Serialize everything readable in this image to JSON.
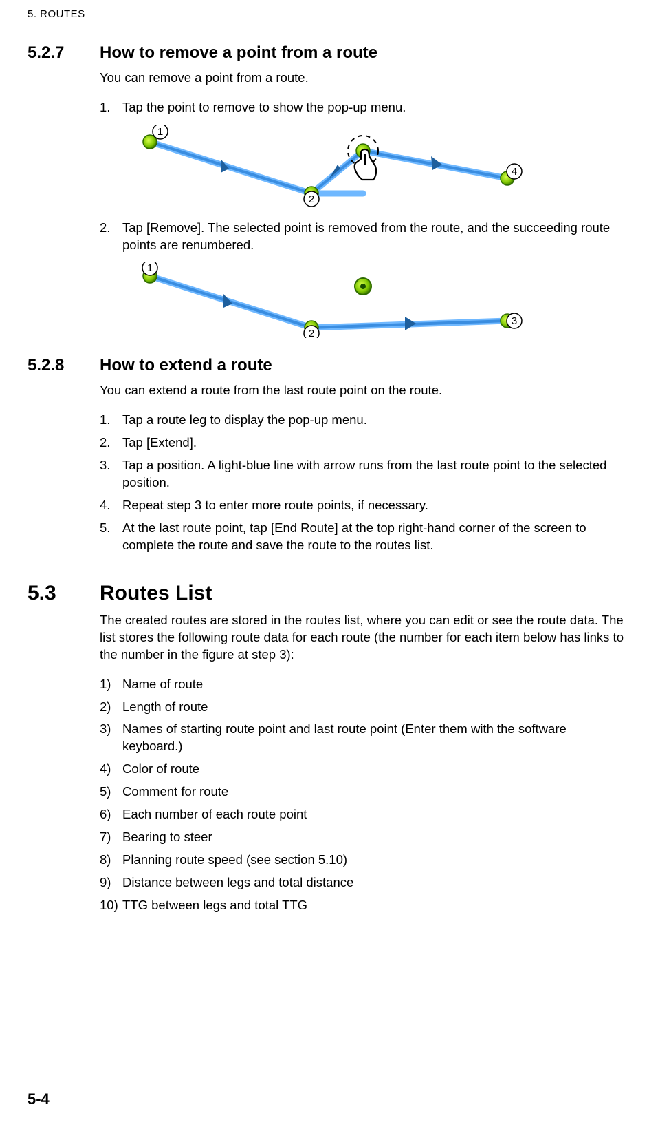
{
  "runningHead": "5.  ROUTES",
  "pageNumber": "5-4",
  "s527": {
    "num": "5.2.7",
    "title": "How to remove a point from a route",
    "intro": "You can remove a point from a route.",
    "steps": [
      {
        "n": "1.",
        "t": "Tap the point to remove to show the pop-up menu."
      },
      {
        "n": "2.",
        "t": "Tap [Remove]. The selected point is removed from the route, and the succeeding route points are renumbered."
      }
    ],
    "fig1": {
      "labels": [
        "1",
        "2",
        "4"
      ]
    },
    "fig2": {
      "labels": [
        "1",
        "2",
        "3"
      ]
    }
  },
  "s528": {
    "num": "5.2.8",
    "title": "How to extend a route",
    "intro": "You can extend a route from the last route point on the route.",
    "steps": [
      {
        "n": "1.",
        "t": "Tap a route leg to display the pop-up menu."
      },
      {
        "n": "2.",
        "t": "Tap [Extend]."
      },
      {
        "n": "3.",
        "t": "Tap a position. A light-blue line with arrow runs from the last route point to the selected position."
      },
      {
        "n": "4.",
        "t": "Repeat step 3 to enter more route points, if necessary."
      },
      {
        "n": "5.",
        "t": "At the last route point, tap [End Route] at the top right-hand corner of the screen to complete the route and save the route to the routes list."
      }
    ]
  },
  "s53": {
    "num": "5.3",
    "title": "Routes List",
    "intro": "The created routes are stored in the routes list, where you can edit or see the route data. The list stores the following route data for each route (the number for each item below has links to the number in the figure at step 3):",
    "items": [
      {
        "n": "1)",
        "t": "Name of route"
      },
      {
        "n": "2)",
        "t": "Length of route"
      },
      {
        "n": "3)",
        "t": "Names of starting route point and last route point (Enter them with the software keyboard.)"
      },
      {
        "n": "4)",
        "t": "Color of route"
      },
      {
        "n": "5)",
        "t": "Comment for route"
      },
      {
        "n": "6)",
        "t": "Each number of each route point"
      },
      {
        "n": "7)",
        "t": "Bearing to steer"
      },
      {
        "n": "8)",
        "t": "Planning route speed (see section 5.10)"
      },
      {
        "n": "9)",
        "t": "Distance between legs and total distance"
      },
      {
        "n": "10)",
        "t": "TTG between legs and total TTG"
      }
    ]
  }
}
